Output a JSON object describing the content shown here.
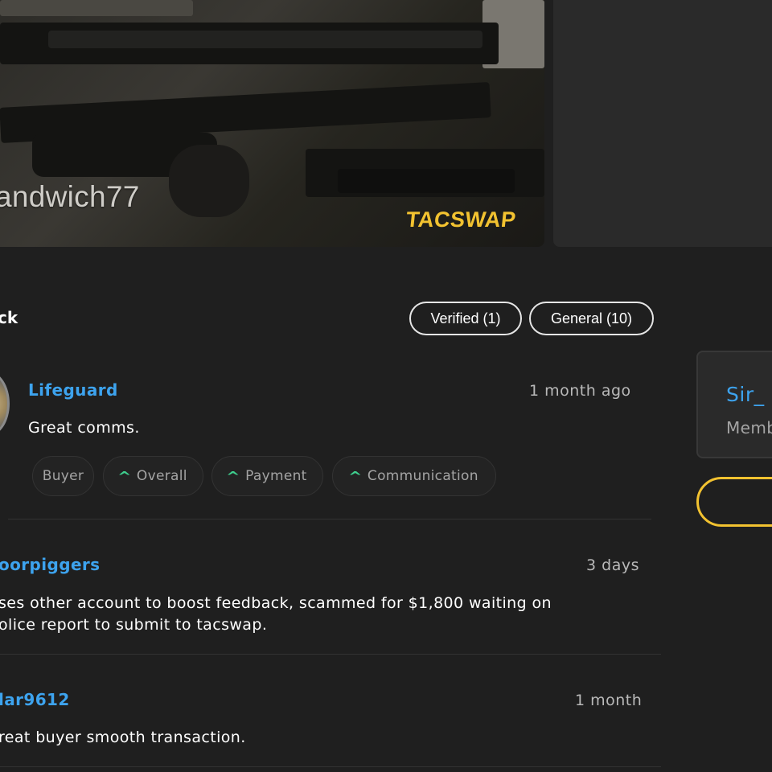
{
  "banner": {
    "username": "andwich77",
    "brand": "TACSWAP"
  },
  "feedback": {
    "title": "ck",
    "filters": [
      {
        "label": "Verified (1)"
      },
      {
        "label": "General (10)"
      }
    ],
    "items": [
      {
        "author": "Lifeguard",
        "time": "1 month ago",
        "text": "Great comms.",
        "tags": [
          "Buyer",
          "Overall",
          "Payment",
          "Communication"
        ]
      },
      {
        "author": "oorpiggers",
        "time": "3 days",
        "text_line1": "ses other account to boost feedback, scammed for $1,800 waiting on",
        "text_line2": "olice report to submit to tacswap."
      },
      {
        "author": "lar9612",
        "time": "1 month",
        "text": "reat buyer smooth transaction."
      }
    ]
  },
  "seller": {
    "name": "Sir_",
    "role": "Memb"
  },
  "colors": {
    "background": "#1f1f1f",
    "accent_blue": "#3da3ee",
    "accent_yellow": "#f2c230",
    "positive_green": "#3ecf8e"
  }
}
